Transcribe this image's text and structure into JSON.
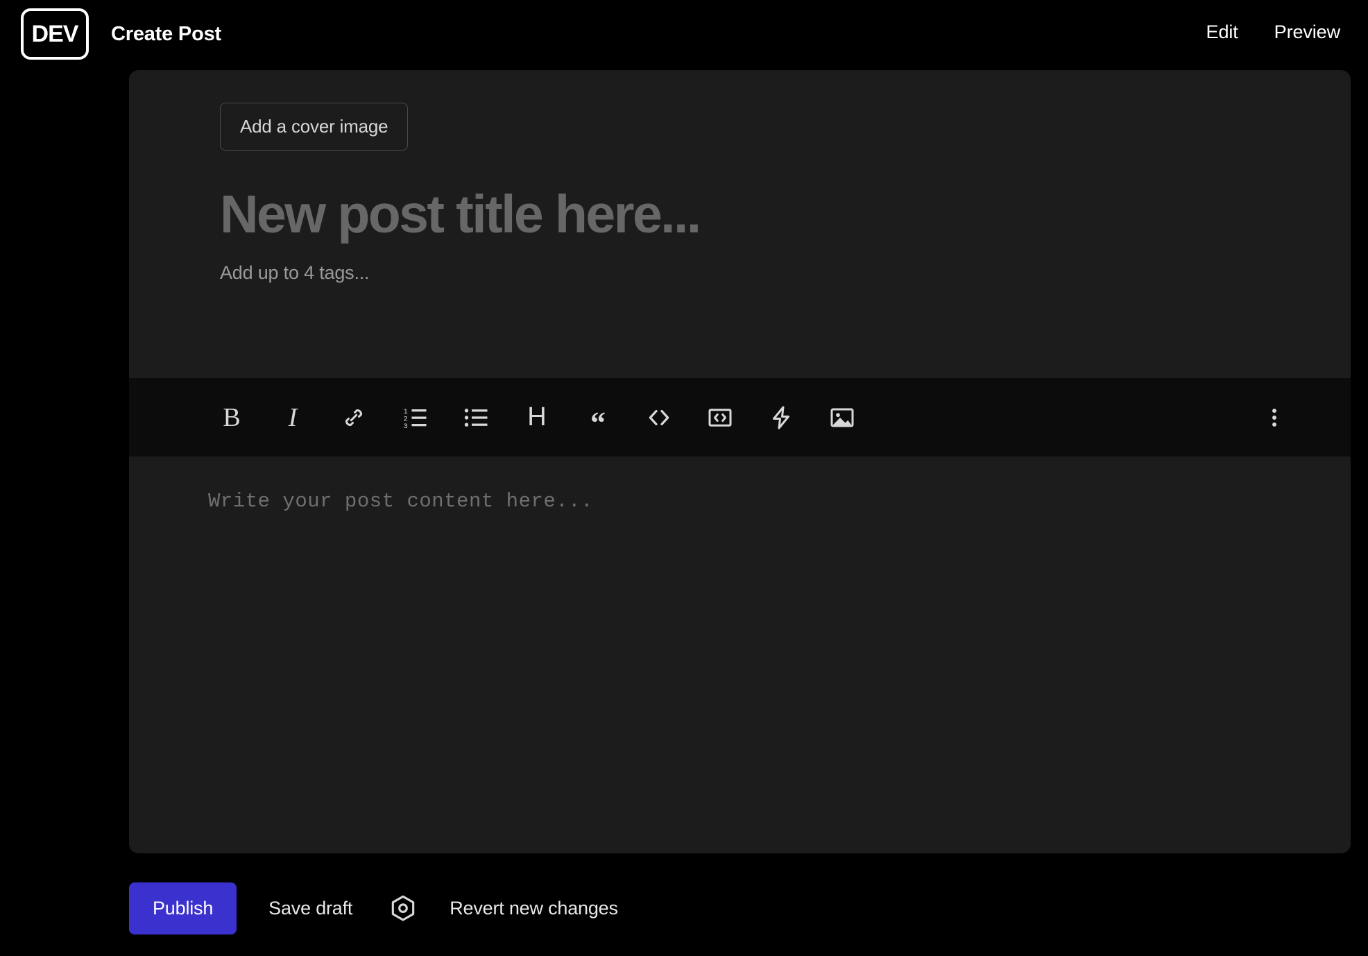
{
  "app": {
    "logo_text": "DEV",
    "page_title": "Create Post"
  },
  "nav": {
    "edit_label": "Edit",
    "preview_label": "Preview"
  },
  "editor": {
    "cover_button_label": "Add a cover image",
    "title_placeholder": "New post title here...",
    "title_value": "",
    "tags_placeholder": "Add up to 4 tags...",
    "tags_value": "",
    "content_placeholder": "Write your post content here...",
    "content_value": ""
  },
  "toolbar": {
    "items": [
      {
        "name": "bold",
        "glyph": "B",
        "title": "Bold"
      },
      {
        "name": "italic",
        "glyph": "I",
        "title": "Italic"
      },
      {
        "name": "link",
        "glyph": "",
        "title": "Link"
      },
      {
        "name": "ordered-list",
        "glyph": "",
        "title": "Ordered list"
      },
      {
        "name": "unordered-list",
        "glyph": "",
        "title": "Unordered list"
      },
      {
        "name": "heading",
        "glyph": "H",
        "title": "Heading"
      },
      {
        "name": "quote",
        "glyph": "“",
        "title": "Quote"
      },
      {
        "name": "code",
        "glyph": "",
        "title": "Code"
      },
      {
        "name": "code-block",
        "glyph": "",
        "title": "Code block"
      },
      {
        "name": "embed",
        "glyph": "",
        "title": "Embed"
      },
      {
        "name": "image",
        "glyph": "",
        "title": "Image upload"
      }
    ],
    "overflow_title": "More options"
  },
  "actions": {
    "publish_label": "Publish",
    "save_draft_label": "Save draft",
    "settings_title": "Post options",
    "revert_label": "Revert new changes"
  },
  "colors": {
    "page_background": "#000000",
    "panel_background": "#1c1c1c",
    "toolbar_background": "#0c0c0c",
    "publish_accent": "#3b31cf",
    "placeholder_text": "#6f6f6f",
    "primary_text": "#ffffff"
  }
}
